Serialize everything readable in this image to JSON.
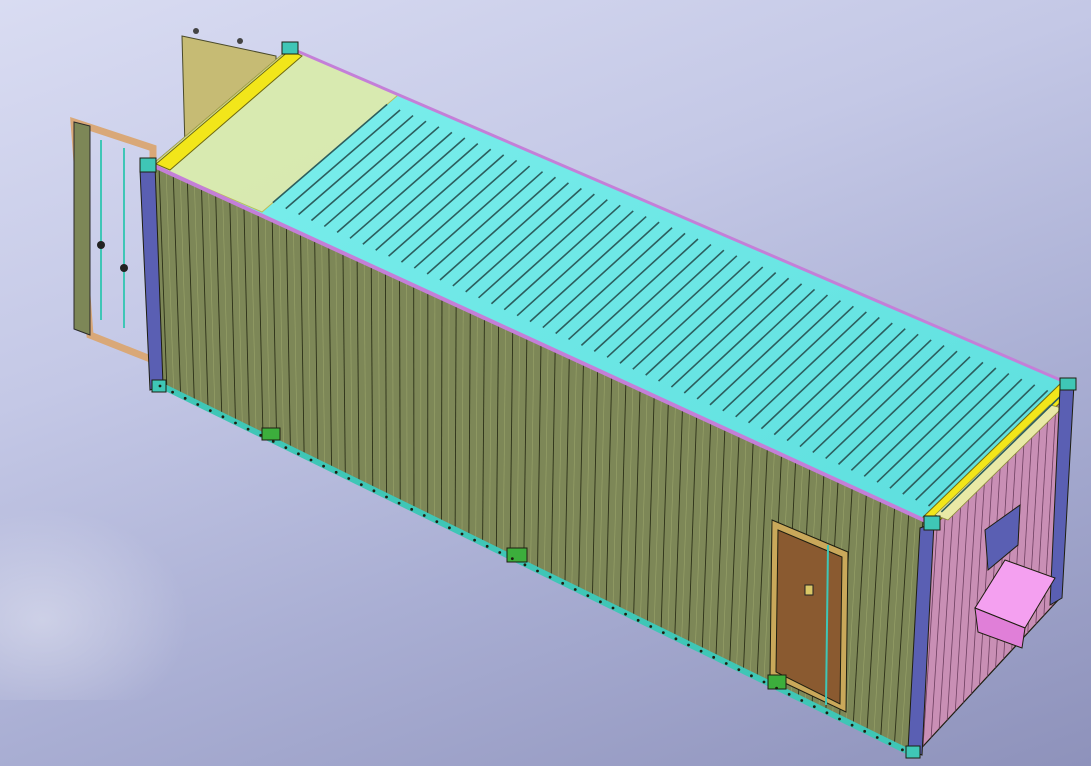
{
  "viewport": {
    "background_top": "#d9dcf2",
    "background_bottom": "#8e92bb"
  },
  "model": {
    "roof_color": "#66e8e6",
    "side_wall_color": "#7d8757",
    "end_wall_color": "#c98fb5",
    "corner_post_color": "#5a5fb3",
    "corner_casting_color": "#f2e61a",
    "base_rail_color": "#3fc6b6",
    "top_rail_color": "#c47fd8",
    "door_color": "#8a5a30",
    "door_frame_color": "#c9a85a",
    "open_door_frame_color": "#d9a878",
    "cooling_unit_color": "#f4a0f0",
    "fork_pocket_color": "#3cae3c",
    "open_door_panel_color": "#c6bb74"
  }
}
